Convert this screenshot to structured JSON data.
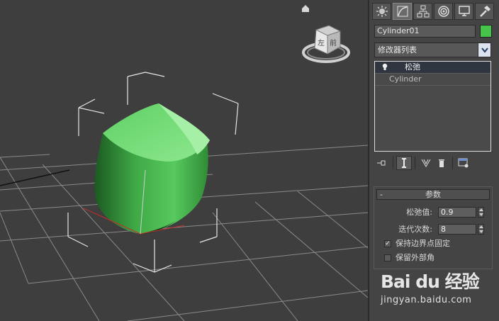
{
  "viewport": {
    "home_icon": "home-icon",
    "viewcube_face": "左 前"
  },
  "command_panel": {
    "tabs": [
      {
        "icon": "sun-create-icon"
      },
      {
        "icon": "modify-curve-icon"
      },
      {
        "icon": "hierarchy-icon"
      },
      {
        "icon": "motion-icon"
      },
      {
        "icon": "display-monitor-icon"
      },
      {
        "icon": "utilities-hammer-icon"
      }
    ],
    "object_name": "Cylinder01",
    "object_color": "#46c34b",
    "modifier_list": "修改器列表",
    "stack": {
      "selected": "松弛",
      "base": "Cylinder"
    },
    "rollout": {
      "minus": "-",
      "title": "参数",
      "relax_label": "松弛值:",
      "relax_value": "0.9",
      "iter_label": "迭代次数:",
      "iter_value": "8",
      "keep_boundary_label": "保持边界点固定",
      "keep_boundary_checked": "✓",
      "save_outer_label": "保留外部角"
    }
  },
  "watermark": {
    "logo": "Bai du 经验",
    "url": "jingyan.baidu.com"
  }
}
